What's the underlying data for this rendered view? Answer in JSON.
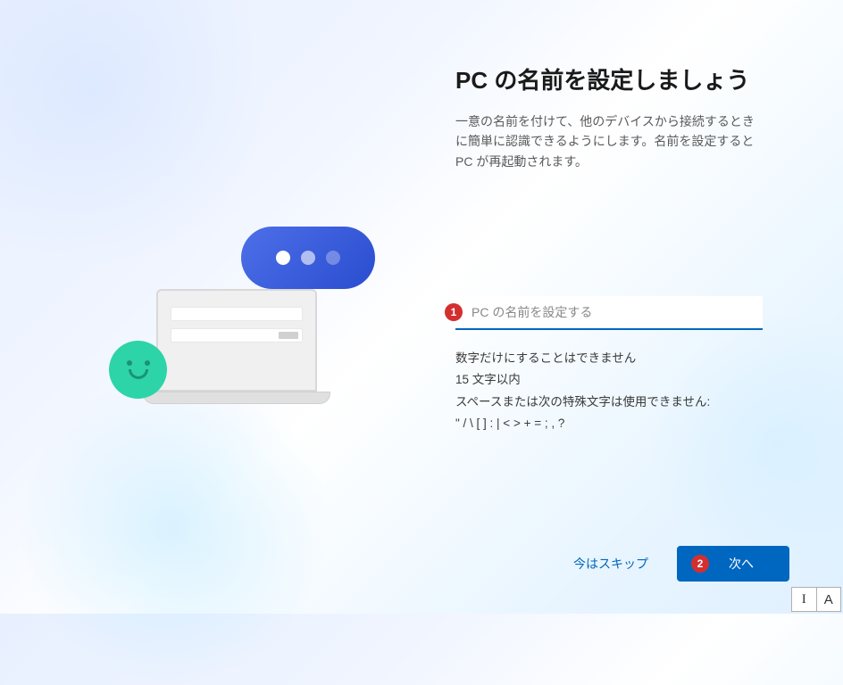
{
  "header": {
    "title": "PC の名前を設定しましょう",
    "subtitle": "一意の名前を付けて、他のデバイスから接続するときに簡単に認識できるようにします。名前を設定すると PC が再起動されます。"
  },
  "input": {
    "placeholder": "PC の名前を設定する",
    "value": ""
  },
  "rules": {
    "line1": "数字だけにすることはできません",
    "line2": "15 文字以内",
    "line3": "スペースまたは次の特殊文字は使用できません:",
    "line4": "\" / \\ [ ] : | < > + = ; , ?"
  },
  "footer": {
    "skip_label": "今はスキップ",
    "next_label": "次へ"
  },
  "annotations": {
    "badge1": "1",
    "badge2": "2"
  },
  "ime": {
    "mode1": "I",
    "mode2": "A"
  }
}
